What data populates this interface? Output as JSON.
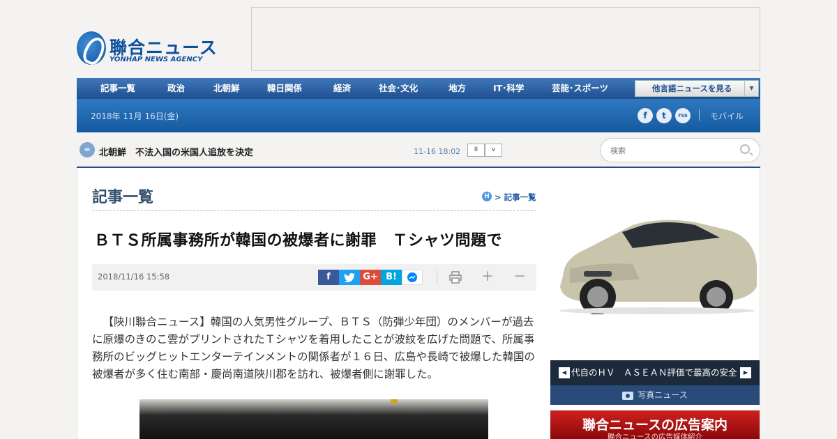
{
  "brand": {
    "name": "聯合ニュース",
    "sub": "YONHAP NEWS AGENCY"
  },
  "nav": {
    "items": [
      "記事一覧",
      "政治",
      "北朝鮮",
      "韓日関係",
      "経済",
      "社会･文化",
      "地方",
      "IT･科学",
      "芸能･スポーツ"
    ],
    "language_select": "他言語ニュースを見る"
  },
  "subbar": {
    "date": "2018年 11月 16日(金)",
    "social": [
      "f",
      "t",
      "rss"
    ],
    "mobile": "モバイル"
  },
  "ticker": {
    "text": "北朝鮮　不法入国の米国人追放を決定",
    "time": "11-16 18:02",
    "pause": "II",
    "next": "∨"
  },
  "search": {
    "placeholder": "検索"
  },
  "article": {
    "section": "記事一覧",
    "breadcrumb_home": "H",
    "breadcrumb": "> 記事一覧",
    "headline": "ＢＴＳ所属事務所が韓国の被爆者に謝罪　Ｔシャツ問題で",
    "date": "2018/11/16 15:58",
    "share": [
      "f",
      "",
      "G+",
      "B!",
      ""
    ],
    "body": "【陜川聯合ニュース】韓国の人気男性グループ、ＢＴＳ（防弾少年団）のメンバーが過去に原爆のきのこ雲がプリントされたＴシャツを着用したことが波紋を広げた問題で、所属事務所のビッグヒットエンターテインメントの関係者が１６日、広島や長崎で被爆した韓国の被爆者が多く住む南部・慶尚南道陜川郡を訪れ、被爆者側に謝罪した。"
  },
  "sidebar": {
    "caption": "代自のＨＶ　ＡＳＥＡＮ評価で最高の安全",
    "prev": "◀",
    "next": "▶",
    "photo_news": "写真ニュース",
    "ad_title": "聯合ニュースの広告案内",
    "ad_sub": "聯合ニュースの広告媒体紹介"
  },
  "colors": {
    "brand": "#0d4f9e",
    "nav": "#1f4f8f",
    "ad": "#d02020"
  }
}
